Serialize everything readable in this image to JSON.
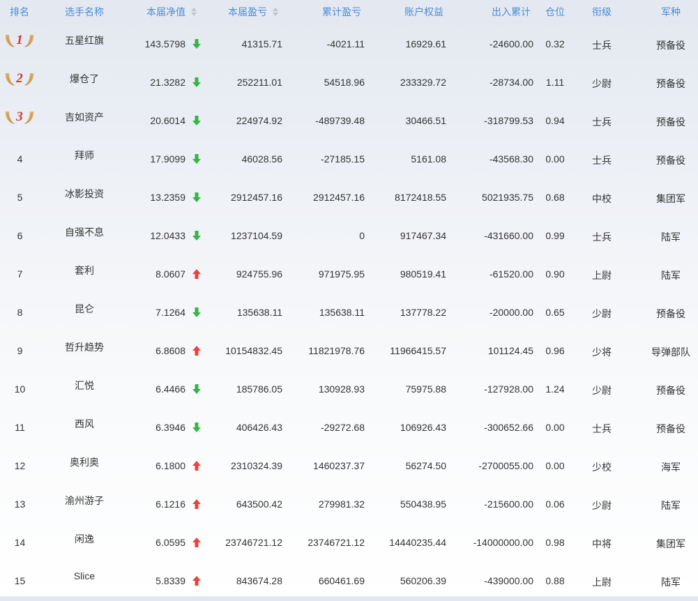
{
  "header": {
    "rank": "排名",
    "name": "选手名称",
    "nav": "本届净值",
    "profit": "本届盈亏",
    "cum_profit": "累计盈亏",
    "equity": "账户权益",
    "flow": "出入累计",
    "position": "仓位",
    "military_rank": "衔级",
    "arm": "军种",
    "sort_icon": "sort-icon"
  },
  "colors": {
    "header_text": "#4a8cd8",
    "up": "#e8433c",
    "down": "#34b544",
    "medal_number": "#d8332d",
    "medal_wing": "#d9b06a"
  },
  "rows": [
    {
      "rank": "1",
      "medal": true,
      "name": "五星红旗",
      "nav": "143.5798",
      "trend": "down",
      "profit": "41315.71",
      "cum_profit": "-4021.11",
      "equity": "16929.61",
      "flow": "-24600.00",
      "position": "0.32",
      "military_rank": "士兵",
      "arm": "预备役"
    },
    {
      "rank": "2",
      "medal": true,
      "name": "爆仓了",
      "nav": "21.3282",
      "trend": "down",
      "profit": "252211.01",
      "cum_profit": "54518.96",
      "equity": "233329.72",
      "flow": "-28734.00",
      "position": "1.11",
      "military_rank": "少尉",
      "arm": "预备役"
    },
    {
      "rank": "3",
      "medal": true,
      "name": "吉如资产",
      "nav": "20.6014",
      "trend": "down",
      "profit": "224974.92",
      "cum_profit": "-489739.48",
      "equity": "30466.51",
      "flow": "-318799.53",
      "position": "0.94",
      "military_rank": "士兵",
      "arm": "预备役"
    },
    {
      "rank": "4",
      "medal": false,
      "name": "拜师",
      "nav": "17.9099",
      "trend": "down",
      "profit": "46028.56",
      "cum_profit": "-27185.15",
      "equity": "5161.08",
      "flow": "-43568.30",
      "position": "0.00",
      "military_rank": "士兵",
      "arm": "预备役"
    },
    {
      "rank": "5",
      "medal": false,
      "name": "冰影投资",
      "nav": "13.2359",
      "trend": "down",
      "profit": "2912457.16",
      "cum_profit": "2912457.16",
      "equity": "8172418.55",
      "flow": "5021935.75",
      "position": "0.68",
      "military_rank": "中校",
      "arm": "集团军"
    },
    {
      "rank": "6",
      "medal": false,
      "name": "自强不息",
      "nav": "12.0433",
      "trend": "down",
      "profit": "1237104.59",
      "cum_profit": "0",
      "equity": "917467.34",
      "flow": "-431660.00",
      "position": "0.99",
      "military_rank": "士兵",
      "arm": "陆军"
    },
    {
      "rank": "7",
      "medal": false,
      "name": "套利",
      "nav": "8.0607",
      "trend": "up",
      "profit": "924755.96",
      "cum_profit": "971975.95",
      "equity": "980519.41",
      "flow": "-61520.00",
      "position": "0.90",
      "military_rank": "上尉",
      "arm": "陆军"
    },
    {
      "rank": "8",
      "medal": false,
      "name": "昆仑",
      "nav": "7.1264",
      "trend": "down",
      "profit": "135638.11",
      "cum_profit": "135638.11",
      "equity": "137778.22",
      "flow": "-20000.00",
      "position": "0.65",
      "military_rank": "少尉",
      "arm": "预备役"
    },
    {
      "rank": "9",
      "medal": false,
      "name": "哲升趋势",
      "nav": "6.8608",
      "trend": "up",
      "profit": "10154832.45",
      "cum_profit": "11821978.76",
      "equity": "11966415.57",
      "flow": "101124.45",
      "position": "0.96",
      "military_rank": "少将",
      "arm": "导弹部队"
    },
    {
      "rank": "10",
      "medal": false,
      "name": "汇悦",
      "nav": "6.4466",
      "trend": "down",
      "profit": "185786.05",
      "cum_profit": "130928.93",
      "equity": "75975.88",
      "flow": "-127928.00",
      "position": "1.24",
      "military_rank": "少尉",
      "arm": "预备役"
    },
    {
      "rank": "11",
      "medal": false,
      "name": "西风",
      "nav": "6.3946",
      "trend": "down",
      "profit": "406426.43",
      "cum_profit": "-29272.68",
      "equity": "106926.43",
      "flow": "-300652.66",
      "position": "0.00",
      "military_rank": "士兵",
      "arm": "预备役"
    },
    {
      "rank": "12",
      "medal": false,
      "name": "奥利奥",
      "nav": "6.1800",
      "trend": "up",
      "profit": "2310324.39",
      "cum_profit": "1460237.37",
      "equity": "56274.50",
      "flow": "-2700055.00",
      "position": "0.00",
      "military_rank": "少校",
      "arm": "海军"
    },
    {
      "rank": "13",
      "medal": false,
      "name": "渝州游子",
      "nav": "6.1216",
      "trend": "up",
      "profit": "643500.42",
      "cum_profit": "279981.32",
      "equity": "550438.95",
      "flow": "-215600.00",
      "position": "0.06",
      "military_rank": "少尉",
      "arm": "陆军"
    },
    {
      "rank": "14",
      "medal": false,
      "name": "闲逸",
      "nav": "6.0595",
      "trend": "up",
      "profit": "23746721.12",
      "cum_profit": "23746721.12",
      "equity": "14440235.44",
      "flow": "-14000000.00",
      "position": "0.98",
      "military_rank": "中将",
      "arm": "集团军"
    },
    {
      "rank": "15",
      "medal": false,
      "name": "Slice",
      "nav": "5.8339",
      "trend": "up",
      "profit": "843674.28",
      "cum_profit": "660461.69",
      "equity": "560206.39",
      "flow": "-439000.00",
      "position": "0.88",
      "military_rank": "上尉",
      "arm": "陆军"
    }
  ]
}
